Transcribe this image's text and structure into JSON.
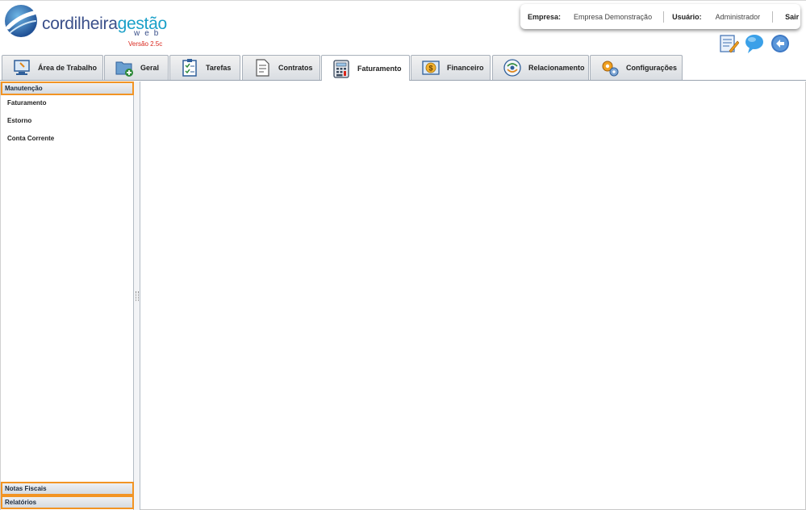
{
  "brand": {
    "name_part1": "cordilheira",
    "name_part2": "gestão",
    "subtitle": "web",
    "version": "Versão 2.5c",
    "colors": {
      "primary": "#3a4f8a",
      "accent": "#1aa0c8",
      "version": "#d9261c"
    }
  },
  "infobar": {
    "empresa_label": "Empresa:",
    "empresa_value": "Empresa Demonstração",
    "usuario_label": "Usuário:",
    "usuario_value": "Administrador",
    "logout_label": "Sair"
  },
  "toolbar_icons": [
    "notes-icon",
    "chat-icon",
    "back-icon"
  ],
  "tabs": [
    {
      "label": "Área de Trabalho",
      "icon": "desktop-icon"
    },
    {
      "label": "Geral",
      "icon": "folder-add-icon"
    },
    {
      "label": "Tarefas",
      "icon": "checklist-icon"
    },
    {
      "label": "Contratos",
      "icon": "document-icon"
    },
    {
      "label": "Faturamento",
      "icon": "calculator-icon",
      "active": true
    },
    {
      "label": "Financeiro",
      "icon": "money-icon"
    },
    {
      "label": "Relacionamento",
      "icon": "contacts-icon"
    },
    {
      "label": "Configurações",
      "icon": "gears-icon"
    }
  ],
  "sidebar": {
    "sections": [
      {
        "title": "Manutenção",
        "items": [
          "Faturamento",
          "Estorno",
          "Conta Corrente"
        ]
      },
      {
        "title": "Notas Fiscais"
      },
      {
        "title": "Relatórios"
      }
    ],
    "highlight_color": "#f29423"
  }
}
